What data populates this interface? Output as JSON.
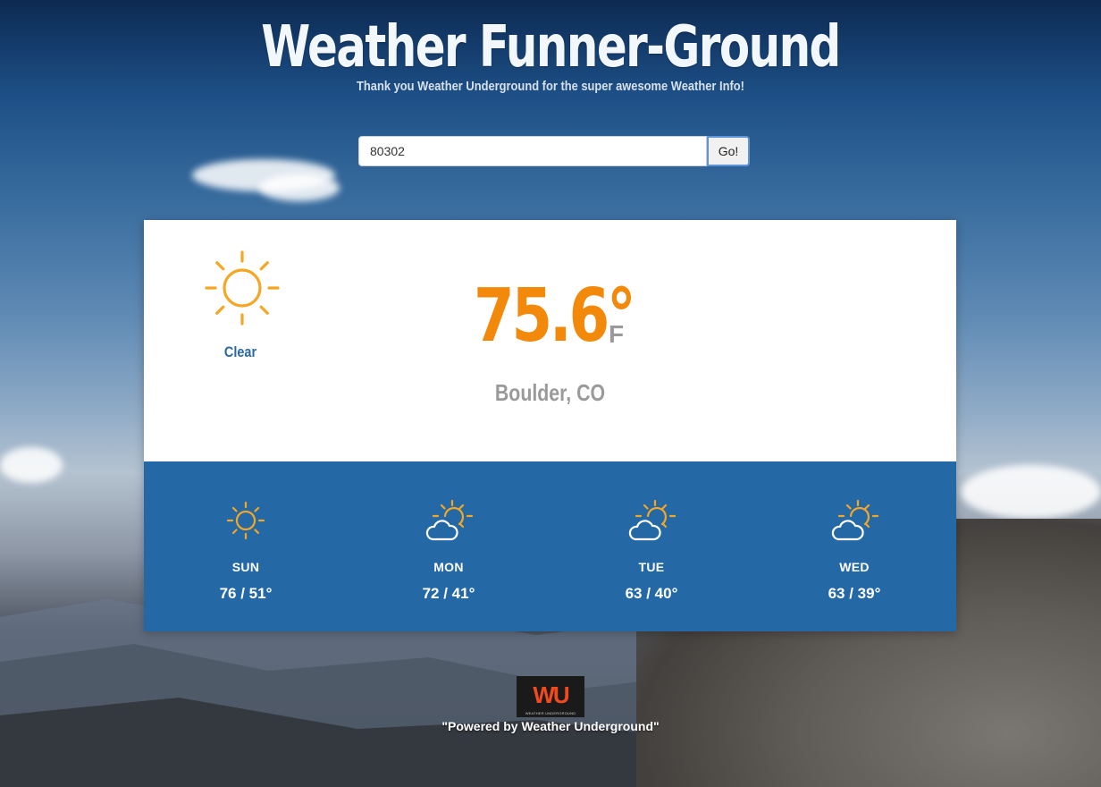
{
  "header": {
    "title": "Weather Funner-Ground",
    "subtitle": "Thank you Weather Underground for the super awesome Weather Info!"
  },
  "search": {
    "value": "80302",
    "button_label": "Go!"
  },
  "current": {
    "icon": "sun-icon",
    "condition": "Clear",
    "temperature": "75.6°",
    "unit": "F",
    "location": "Boulder, CO"
  },
  "forecast": [
    {
      "day": "SUN",
      "range": "76 / 51°",
      "icon": "sun-icon"
    },
    {
      "day": "MON",
      "range": "72 / 41°",
      "icon": "partly-cloudy-icon"
    },
    {
      "day": "TUE",
      "range": "63 / 40°",
      "icon": "partly-cloudy-icon"
    },
    {
      "day": "WED",
      "range": "63 / 39°",
      "icon": "partly-cloudy-icon"
    }
  ],
  "footer": {
    "logo_text": "WU",
    "logo_small": "WEATHER UNDERGROUND",
    "powered_by": "\"Powered by Weather Underground\""
  },
  "colors": {
    "accent": "#f2890b",
    "card_bottom": "#2469a6",
    "condition_text": "#2a6aa3"
  }
}
